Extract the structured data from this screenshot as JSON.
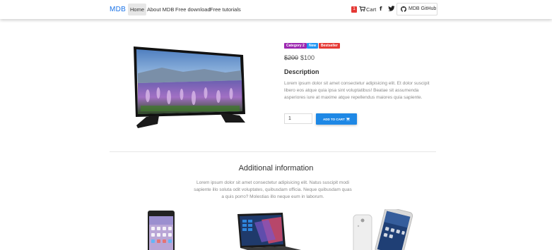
{
  "navbar": {
    "brand": "MDB",
    "links": [
      "Home",
      "About MDB",
      "Free download",
      "Free tutorials"
    ],
    "active_link": "Home",
    "cart_count": "1",
    "cart_label": "Cart",
    "github_label": "MDB GitHub",
    "icons": [
      "shopping-cart-icon",
      "facebook-icon",
      "twitter-icon",
      "github-icon"
    ]
  },
  "product": {
    "badges": [
      {
        "label": "Category 2",
        "color": "#9c27b0"
      },
      {
        "label": "New",
        "color": "#2196f3"
      },
      {
        "label": "Bestseller",
        "color": "#e53935"
      }
    ],
    "old_price": "$200",
    "new_price": "$100",
    "description_title": "Description",
    "description_text": "Lorem ipsum dolor sit amet consectetur adipisicing elit. Et dolor suscipit libero eos atque quia ipsa sint voluptatibus! Beatae sit assumenda asperiores iure at maxime atque repellendus maiores quia sapiente.",
    "quantity": "1",
    "add_to_cart_label": "ADD TO CART"
  },
  "additional": {
    "title": "Additional information",
    "text": "Lorem ipsum dolor sit amet consectetur adipisicing elit. Natus suscipit modi sapiente illo soluta odit voluptates, quibusdam officia. Neque quibusdam quas a quis porro? Molestias illo neque eum in laborum."
  },
  "colors": {
    "brand": "#1a73e8",
    "button": "#1e88e5",
    "cart_badge": "#e53935"
  }
}
